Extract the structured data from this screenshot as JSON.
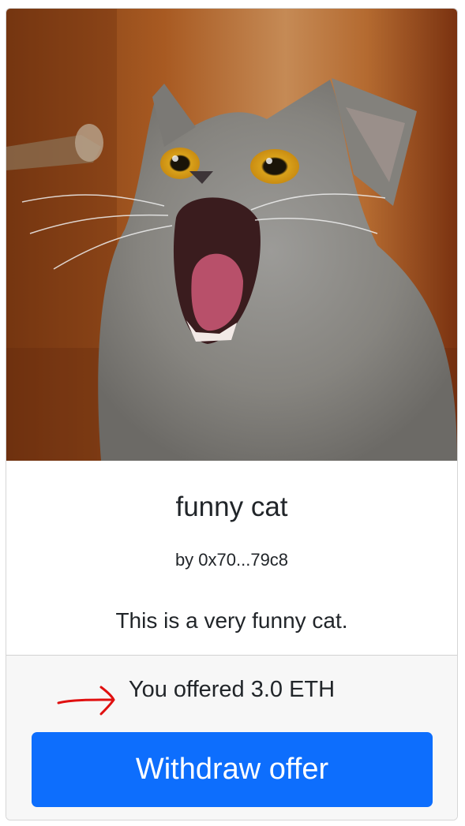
{
  "nft": {
    "image_alt": "gray cat with mouth open",
    "title": "funny cat",
    "creator": "by 0x70...79c8",
    "description": "This is a very funny cat."
  },
  "offer": {
    "status_text": "You offered 3.0 ETH",
    "annotation_icon": "red-hand-drawn-arrow-icon"
  },
  "actions": {
    "withdraw_label": "Withdraw offer"
  },
  "colors": {
    "primary": "#0d6efd",
    "footer_bg": "#f7f7f7",
    "annotation": "#e01010"
  }
}
